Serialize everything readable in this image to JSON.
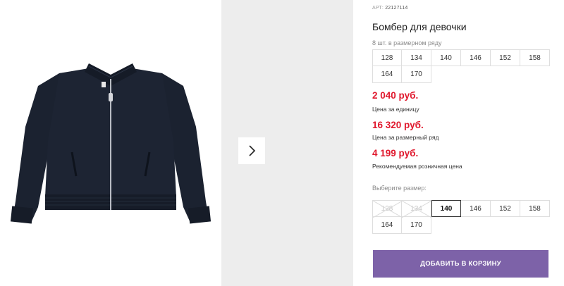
{
  "product": {
    "art_label": "АРТ:",
    "art_value": "22127114",
    "title": "Бомбер для девочки",
    "image_icon": "jacket-image"
  },
  "gallery": {
    "next_icon": "chevron-right-icon"
  },
  "pack": {
    "label": "8 шт. в размерном ряду",
    "sizes": [
      "128",
      "134",
      "140",
      "146",
      "152",
      "158",
      "164",
      "170"
    ]
  },
  "prices": {
    "unit_price": "2 040 руб.",
    "unit_label": "Цена за единицу",
    "pack_price": "16 320 руб.",
    "pack_label": "Цена за размерный ряд",
    "retail_price": "4 199 руб.",
    "retail_label": "Рекомендуемая розничная цена",
    "price_color": "#e0182d"
  },
  "choose": {
    "label": "Выберите размер:",
    "sizes": [
      {
        "value": "128",
        "state": "disabled"
      },
      {
        "value": "134",
        "state": "disabled"
      },
      {
        "value": "140",
        "state": "selected"
      },
      {
        "value": "146",
        "state": "available"
      },
      {
        "value": "152",
        "state": "available"
      },
      {
        "value": "158",
        "state": "available"
      },
      {
        "value": "164",
        "state": "available"
      },
      {
        "value": "170",
        "state": "available"
      }
    ]
  },
  "cart": {
    "add_label": "ДОБАВИТЬ В КОРЗИНУ",
    "button_color": "#7d62a8"
  }
}
